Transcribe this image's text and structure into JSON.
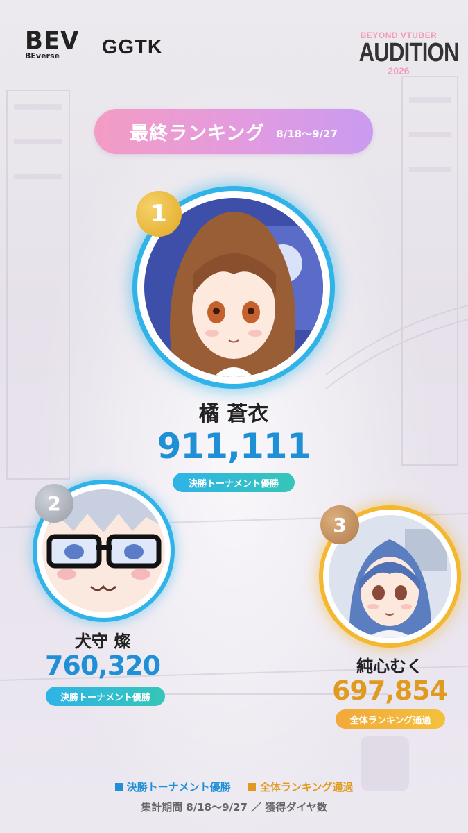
{
  "logos": {
    "bev_mark": "BEV",
    "bev_sub": "BEverse",
    "ggtk": "GGTK",
    "audition_top": "BEYOND VTUBER",
    "audition_main": "AUDITION",
    "audition_year": "2026"
  },
  "title": {
    "main": "最終ランキング",
    "period": "8/18〜9/27"
  },
  "ranking": [
    {
      "rank": "1",
      "name": "橘 蒼衣",
      "score": "911,111",
      "tag": "決勝トーナメント優勝",
      "ring_color": "#2fb3e8",
      "badge_color": "#e8b93a",
      "score_color": "#1f8fd6"
    },
    {
      "rank": "2",
      "name": "犬守 燦",
      "score": "760,320",
      "tag": "決勝トーナメント優勝",
      "ring_color": "#2fb3e8",
      "badge_color": "#a9adb5",
      "score_color": "#1f8fd6"
    },
    {
      "rank": "3",
      "name": "純心むく",
      "score": "697,854",
      "tag": "全体ランキング通過",
      "ring_color": "#f3b730",
      "badge_color": "#c1905f",
      "score_color": "#e09a1f"
    }
  ],
  "legend": {
    "blue_label": "決勝トーナメント優勝",
    "gold_label": "全体ランキング通過",
    "blue_color": "#1f8fd6",
    "gold_color": "#e09a1f"
  },
  "footnote": "集計期間 8/18〜9/27 ／ 獲得ダイヤ数"
}
